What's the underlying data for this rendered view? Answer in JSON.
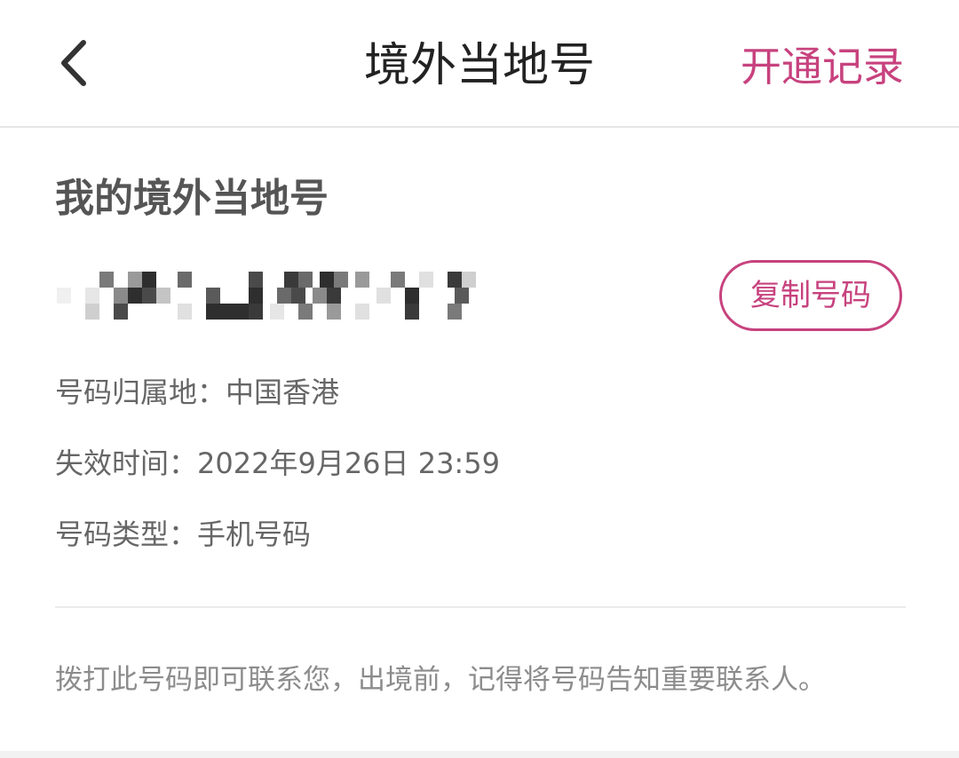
{
  "header": {
    "title": "境外当地号",
    "records_link": "开通记录",
    "back_icon": "chevron-left-icon"
  },
  "card": {
    "section_title": "我的境外当地号",
    "copy_button": "复制号码",
    "rows": [
      {
        "label": "号码归属地：",
        "value": "中国香港"
      },
      {
        "label": "失效时间：",
        "value": "2022年9月26日 23:59"
      },
      {
        "label": "号码类型：",
        "value": "手机号码"
      }
    ]
  },
  "notice": "拨打此号码即可联系您，出境前，记得将号码告知重要联系人。",
  "colors": {
    "accent": "#c7427e",
    "title": "#222222",
    "body": "#666666",
    "muted": "#8c8c8c"
  }
}
